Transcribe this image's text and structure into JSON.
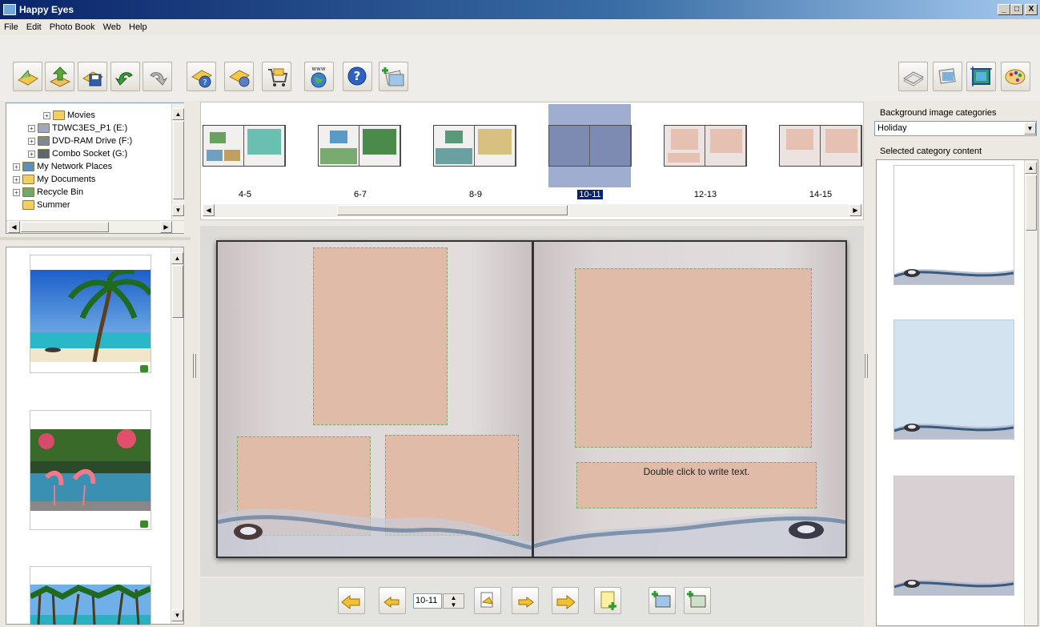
{
  "window": {
    "title": "Happy Eyes",
    "controls": {
      "minimize": "_",
      "maximize": "□",
      "close": "X"
    }
  },
  "menu": [
    "File",
    "Edit",
    "Photo Book",
    "Web",
    "Help"
  ],
  "toolbar": {
    "left": [
      "open-book-icon",
      "upload-icon",
      "save-icon",
      "undo-icon",
      "redo-icon",
      "properties-help-icon",
      "book-settings-icon",
      "shop-cart-icon",
      "www-globe-icon",
      "help-icon",
      "add-photos-icon"
    ],
    "right": [
      "page-layout-icon",
      "photo-edit-icon",
      "frame-icon",
      "palette-icon"
    ]
  },
  "folder_tree": {
    "items": [
      {
        "label": "Movies",
        "indent": 2,
        "icon": "folder-icon",
        "expander": "+"
      },
      {
        "label": "TDWC3ES_P1 (E:)",
        "indent": 1,
        "icon": "cd-icon",
        "expander": "+"
      },
      {
        "label": "DVD-RAM Drive (F:)",
        "indent": 1,
        "icon": "dvd-icon",
        "expander": "+"
      },
      {
        "label": "Combo Socket (G:)",
        "indent": 1,
        "icon": "drive-icon",
        "expander": "+"
      },
      {
        "label": "My Network Places",
        "indent": 0,
        "icon": "network-icon",
        "expander": "+"
      },
      {
        "label": "My Documents",
        "indent": 0,
        "icon": "folder-icon",
        "expander": "+"
      },
      {
        "label": "Recycle Bin",
        "indent": 0,
        "icon": "recycle-bin-icon",
        "expander": "+"
      },
      {
        "label": "Summer",
        "indent": 0,
        "icon": "folder-icon",
        "expander": ""
      }
    ]
  },
  "photos": [
    "palm-beach",
    "flamingos",
    "palm-shore"
  ],
  "page_strip": {
    "spreads": [
      "4-5",
      "6-7",
      "8-9",
      "10-11",
      "12-13",
      "14-15"
    ],
    "selected": "10-11"
  },
  "book": {
    "text_placeholder": "Double click to write text."
  },
  "navigation": {
    "page_value": "10-11",
    "buttons": [
      "first-page-icon",
      "prev-page-icon",
      "spin-icon",
      "page-order-icon",
      "next-page-icon",
      "last-page-icon",
      "new-page-icon",
      "auto-fill-icon",
      "auto-layout-icon"
    ]
  },
  "right_panel": {
    "categories_label": "Background image categories",
    "selected_category": "Holiday",
    "content_label": "Selected category content",
    "backgrounds": [
      "#ffffff",
      "#d3e3ef",
      "#d8d0d3"
    ]
  },
  "colors": {
    "titlebar": "#0a246a",
    "placeholder": "#e0bba8",
    "selection": "#0a246a"
  }
}
